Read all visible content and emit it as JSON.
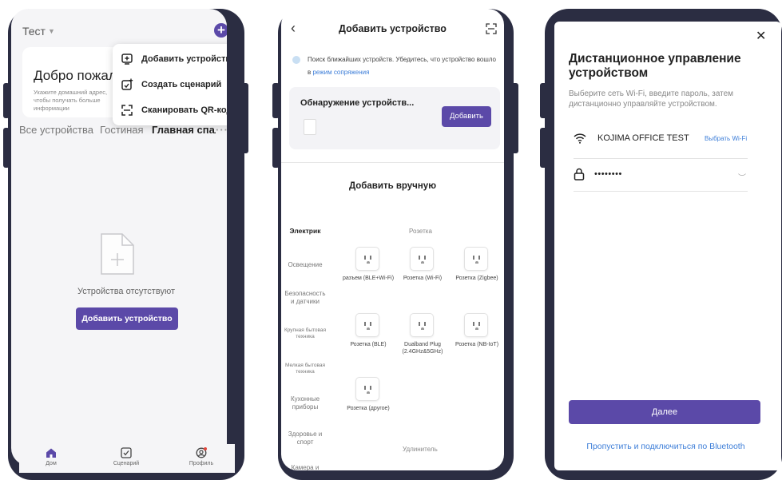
{
  "screen1": {
    "home_title": "Тест",
    "welcome_title": "Добро пожаловать",
    "welcome_subtitle": "Укажите домашний адрес, чтобы получать больше информации",
    "popup_menu": [
      {
        "label": "Добавить устройство",
        "icon": "device-add-icon"
      },
      {
        "label": "Создать сценарий",
        "icon": "scenario-add-icon"
      },
      {
        "label": "Сканировать QR-код",
        "icon": "scan-icon"
      }
    ],
    "tabs": [
      "Все устройства",
      "Гостиная",
      "Главная спальня"
    ],
    "more": "···",
    "empty_text": "Устройства отсутствуют",
    "add_button": "Добавить устройство",
    "nav": [
      {
        "label": "Дом",
        "icon": "home-icon"
      },
      {
        "label": "Сценарий",
        "icon": "scenario-icon"
      },
      {
        "label": "Профиль",
        "icon": "profile-icon"
      }
    ],
    "accent": "#5b49a8"
  },
  "screen2": {
    "title": "Добавить устройство",
    "search_text": "Поиск ближайших устройств. Убедитесь, что устройство вошло в",
    "search_link": "режим сопряжения",
    "discover_title": "Обнаружение устройств...",
    "discover_button": "Добавить",
    "manual_title": "Добавить вручную",
    "categories": [
      "Электрик",
      "Освещение",
      "Безопасность и датчики",
      "Крупная бытовая техника",
      "Мелкая бытовая техника",
      "Кухонные приборы",
      "Здоровье и спорт",
      "Камера и"
    ],
    "section_socket": "Розетка",
    "section_extender": "Удлинитель",
    "devices": [
      "разъем (BLE+Wi-Fi)",
      "Розетка (Wi-Fi)",
      "Розетка (Zigbee)",
      "Розетка (BLE)",
      "Dualband Plug (2.4GHz&5GHz)",
      "Розетка (NB-IoT)",
      "Розетка (другое)"
    ]
  },
  "screen3": {
    "title": "Дистанционное управление устройством",
    "subtitle": "Выберите сеть Wi-Fi, введите пароль, затем дистанционно управляйте устройством.",
    "wifi_name": "KOJIMA OFFICE TEST",
    "choose_wifi": "Выбрать Wi-Fi",
    "password_mask": "••••••••",
    "next_button": "Далее",
    "bluetooth_link": "Пропустить и подключиться по Bluetooth"
  }
}
